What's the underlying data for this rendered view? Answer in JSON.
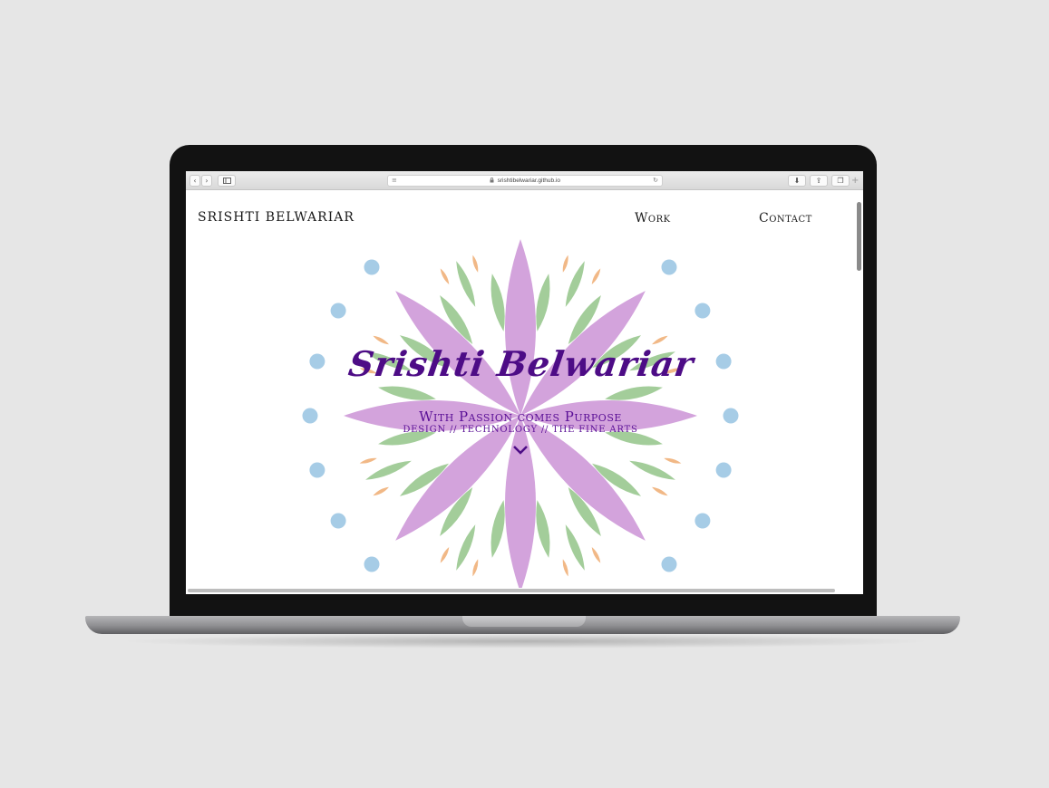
{
  "browser": {
    "url": "srishtibelwariar.github.io",
    "back_icon": "‹",
    "forward_icon": "›",
    "sidebar_icon": "sidebar-icon",
    "reader_icon": "≡",
    "lock_icon": "🔒",
    "reload_icon": "↻",
    "download_icon": "⬇",
    "share_icon": "⇪",
    "tabs_icon": "❐",
    "new_tab_icon": "+"
  },
  "site": {
    "name": "SRISHTI BELWARIAR",
    "nav": {
      "work": "Work",
      "contact": "Contact"
    }
  },
  "hero": {
    "title": "Srishti Belwariar",
    "tagline": "With Passion comes Purpose",
    "subtagline": "DESIGN // TECHNOLOGY // THE FINE ARTS"
  },
  "colors": {
    "petal": "#d3a3dc",
    "leaf": "#a3cd9a",
    "orange": "#f1b886",
    "dot": "#a6cce6",
    "title": "#4d0c86",
    "tagline": "#5a0f96"
  }
}
